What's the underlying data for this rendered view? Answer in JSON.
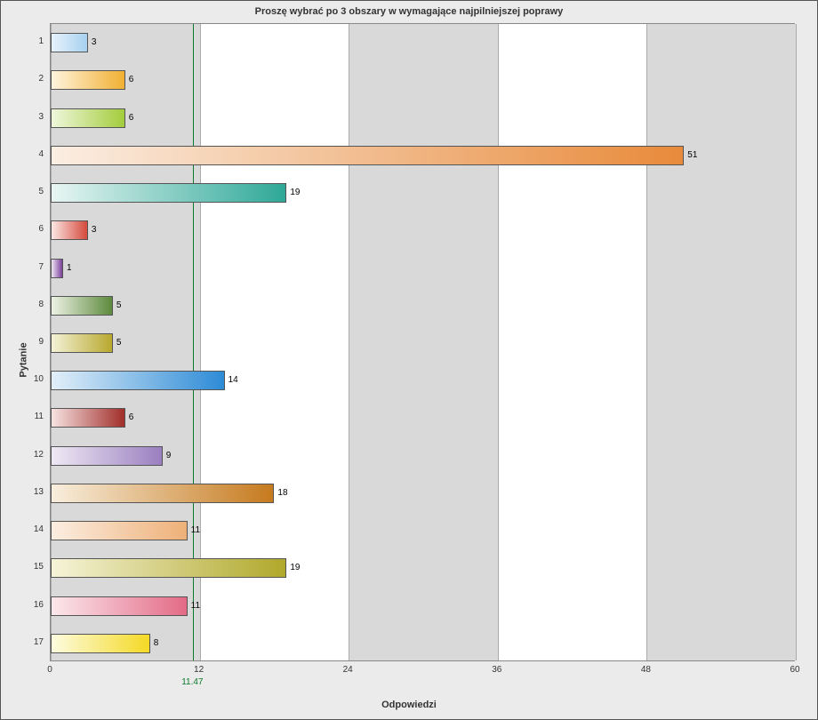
{
  "chart_data": {
    "type": "bar",
    "orientation": "horizontal",
    "title": "Proszę wybrać po 3 obszary w  wymagające najpilniejszej poprawy",
    "xlabel": "Odpowiedzi",
    "ylabel": "Pytanie",
    "xlim": [
      0,
      60
    ],
    "x_ticks": [
      0,
      12,
      24,
      36,
      48,
      60
    ],
    "categories": [
      "1",
      "2",
      "3",
      "4",
      "5",
      "6",
      "7",
      "8",
      "9",
      "10",
      "11",
      "12",
      "13",
      "14",
      "15",
      "16",
      "17"
    ],
    "values": [
      3,
      6,
      6,
      51,
      19,
      3,
      1,
      5,
      5,
      14,
      6,
      9,
      18,
      11,
      19,
      11,
      8
    ],
    "reference_line": 11.47,
    "bar_colors": [
      [
        "#e6f2fb",
        "#a8d1f0"
      ],
      [
        "#fff4de",
        "#f0b032"
      ],
      [
        "#eff7dc",
        "#a3cc3c"
      ],
      [
        "#fbeee3",
        "#e88a3a"
      ],
      [
        "#e8f6f3",
        "#2ea898"
      ],
      [
        "#fbe7e5",
        "#d54a3c"
      ],
      [
        "#efe4f3",
        "#7a3f9a"
      ],
      [
        "#ecf2e5",
        "#5e8a3d"
      ],
      [
        "#f4f2d7",
        "#b8a82e"
      ],
      [
        "#e2eff9",
        "#2d8bd6"
      ],
      [
        "#f6e3e2",
        "#a12e2a"
      ],
      [
        "#efe9f4",
        "#9a7fc0"
      ],
      [
        "#f8eedd",
        "#c67a1e"
      ],
      [
        "#fbeee1",
        "#eeb078"
      ],
      [
        "#f6f4d8",
        "#b0a82a"
      ],
      [
        "#fbe8ec",
        "#e36a86"
      ],
      [
        "#fdfce0",
        "#f4d925"
      ]
    ]
  }
}
